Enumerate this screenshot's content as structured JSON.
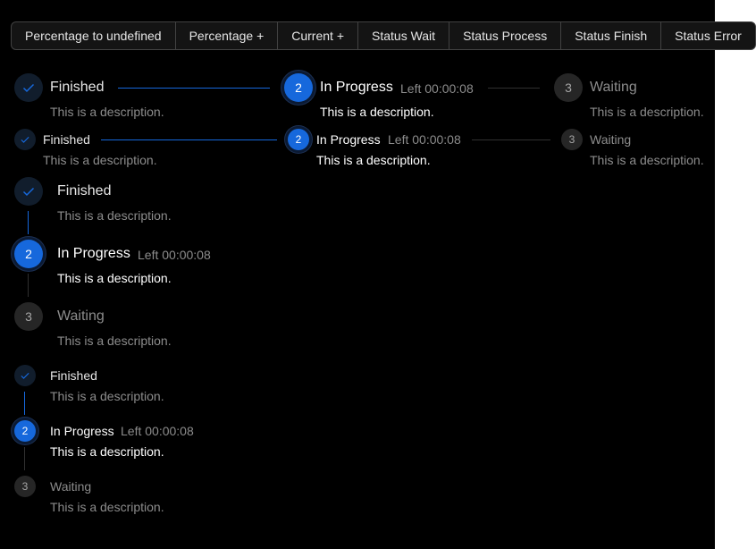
{
  "toolbar": {
    "buttons": [
      "Percentage to undefined",
      "Percentage +",
      "Current +",
      "Status Wait",
      "Status Process",
      "Status Finish",
      "Status Error"
    ]
  },
  "steps": {
    "finished": {
      "title": "Finished",
      "description": "This is a description."
    },
    "in_progress": {
      "number": "2",
      "title": "In Progress",
      "subtitle": "Left 00:00:08",
      "description": "This is a description."
    },
    "waiting": {
      "number": "3",
      "title": "Waiting",
      "description": "This is a description."
    }
  },
  "colors": {
    "primary": "#1668dc",
    "finish_bg": "#111d2c",
    "wait_bg": "#262626",
    "background": "#000000"
  },
  "icons": {
    "finished": "check-icon"
  }
}
